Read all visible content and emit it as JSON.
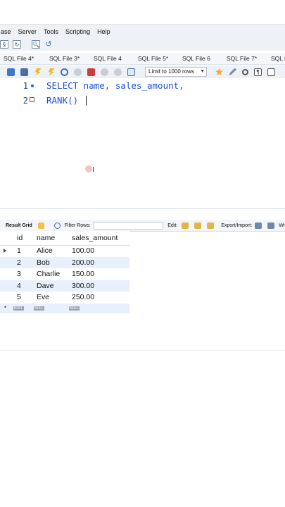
{
  "menubar": {
    "items": [
      "ase",
      "Server",
      "Tools",
      "Scripting",
      "Help"
    ]
  },
  "tabs": [
    "SQL File 4*",
    "SQL File 3*",
    "SQL File 4",
    "SQL File 5*",
    "SQL File 6",
    "SQL File 7*",
    "SQL F"
  ],
  "toolbar": {
    "limit_label": "Limit to 1000 rows"
  },
  "editor": {
    "lines": [
      {
        "num": "1",
        "text": "SELECT name, sales_amount,"
      },
      {
        "num": "2",
        "text": "RANK() "
      }
    ]
  },
  "result_toolbar": {
    "result_grid_label": "Result Grid",
    "filter_label": "Filter Rows:",
    "edit_label": "Edit:",
    "export_label": "Export/Import:",
    "wrap_label": "Wr"
  },
  "grid": {
    "columns": [
      "id",
      "name",
      "sales_amount"
    ],
    "rows": [
      {
        "id": "1",
        "name": "Alice",
        "sales_amount": "100.00"
      },
      {
        "id": "2",
        "name": "Bob",
        "sales_amount": "200.00"
      },
      {
        "id": "3",
        "name": "Charlie",
        "sales_amount": "150.00"
      },
      {
        "id": "4",
        "name": "Dave",
        "sales_amount": "300.00"
      },
      {
        "id": "5",
        "name": "Eve",
        "sales_amount": "250.00"
      }
    ],
    "null_label": "NULL"
  },
  "colors": {
    "keyword": "#1d4ed8",
    "row_alt": "#e8f0fb",
    "toolbar_bg": "#eef1f6"
  }
}
